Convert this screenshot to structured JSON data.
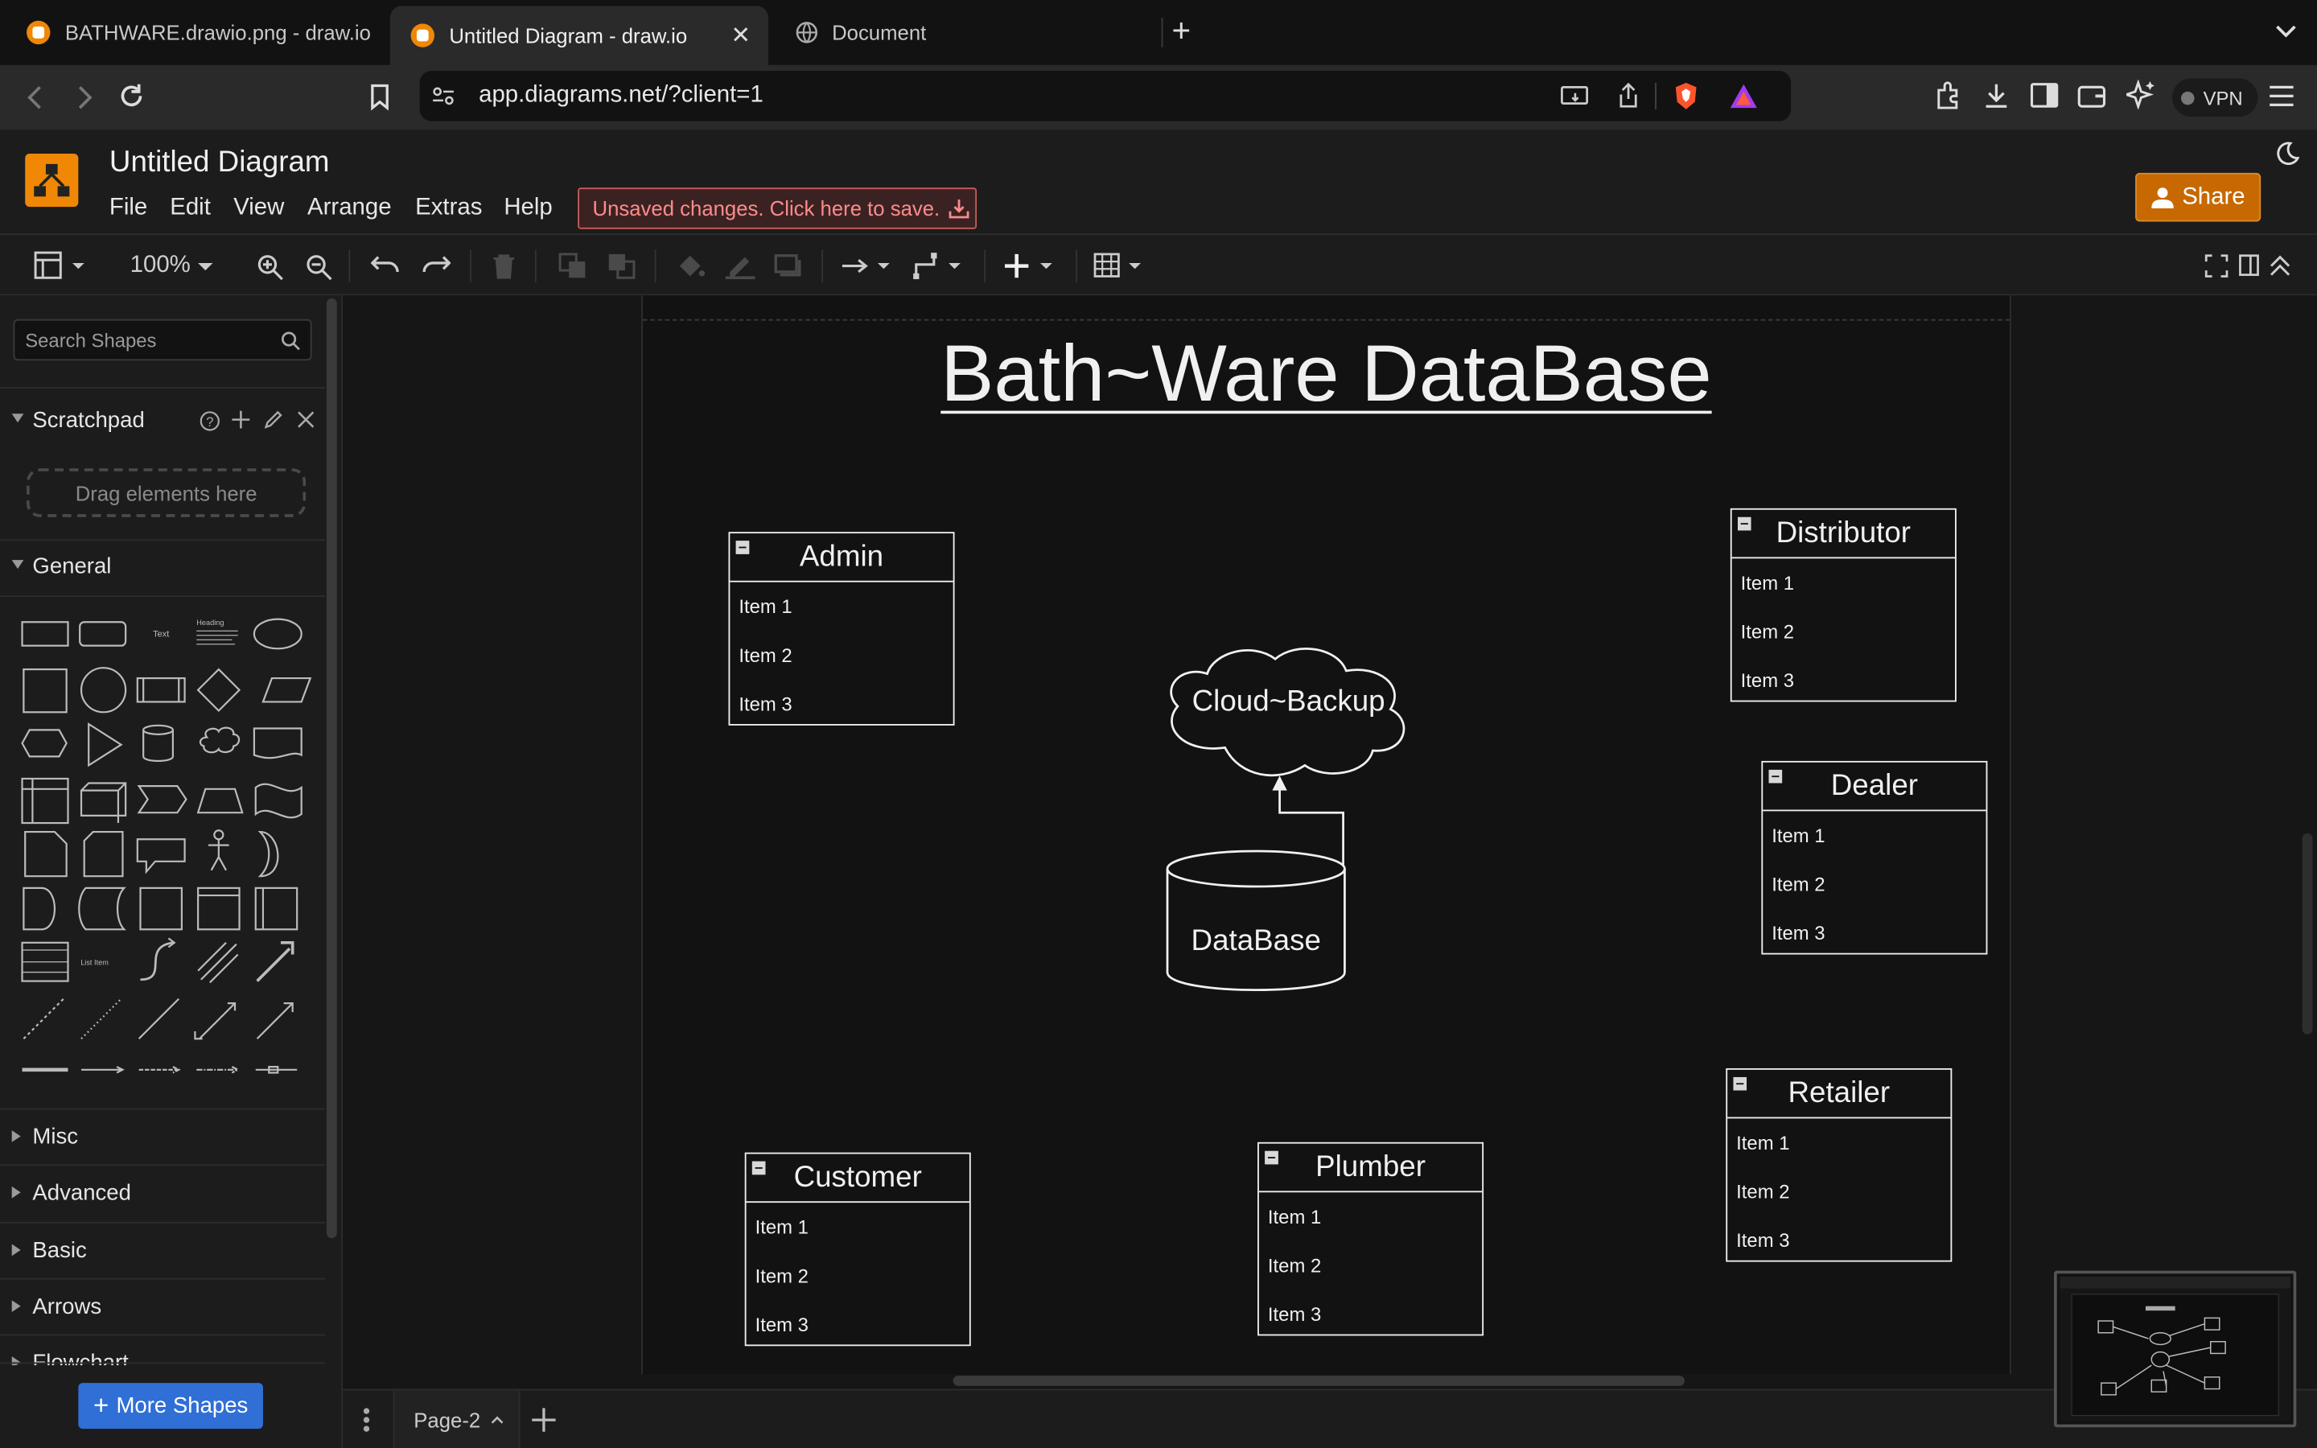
{
  "browser": {
    "tabs": [
      {
        "title": "BATHWARE.drawio.png - draw.io"
      },
      {
        "title": "Untitled Diagram - draw.io"
      },
      {
        "title": "Document"
      }
    ],
    "url": "app.diagrams.net/?client=1",
    "vpn_label": "VPN"
  },
  "app": {
    "title": "Untitled Diagram",
    "menus": [
      "File",
      "Edit",
      "View",
      "Arrange",
      "Extras",
      "Help"
    ],
    "unsaved_notice": "Unsaved changes. Click here to save.",
    "share_label": "Share",
    "zoom": "100%"
  },
  "sidebar": {
    "search_placeholder": "Search Shapes",
    "scratchpad_label": "Scratchpad",
    "drag_hint": "Drag elements here",
    "general_label": "General",
    "palette_text_label": "Text",
    "palette_heading_label": "Heading",
    "palette_list_item_label": "List Item",
    "sections": [
      "Misc",
      "Advanced",
      "Basic",
      "Arrows",
      "Flowchart"
    ],
    "more_shapes_label": "More Shapes"
  },
  "diagram": {
    "title": "Bath~Ware DataBase",
    "cloud_label": "Cloud~Backup",
    "database_label": "DataBase",
    "tables": [
      {
        "name": "Admin",
        "items": [
          "Item 1",
          "Item 2",
          "Item 3"
        ]
      },
      {
        "name": "Distributor",
        "items": [
          "Item 1",
          "Item 2",
          "Item 3"
        ]
      },
      {
        "name": "Dealer",
        "items": [
          "Item 1",
          "Item 2",
          "Item 3"
        ]
      },
      {
        "name": "Retailer",
        "items": [
          "Item 1",
          "Item 2",
          "Item 3"
        ]
      },
      {
        "name": "Customer",
        "items": [
          "Item 1",
          "Item 2",
          "Item 3"
        ]
      },
      {
        "name": "Plumber",
        "items": [
          "Item 1",
          "Item 2",
          "Item 3"
        ]
      }
    ]
  },
  "pages": {
    "current": "Page-2"
  },
  "colors": {
    "accent_orange": "#f08705",
    "share_button": "#c76800",
    "more_shapes_button": "#2f6fd6",
    "unsaved_text": "#ff8b8b"
  }
}
